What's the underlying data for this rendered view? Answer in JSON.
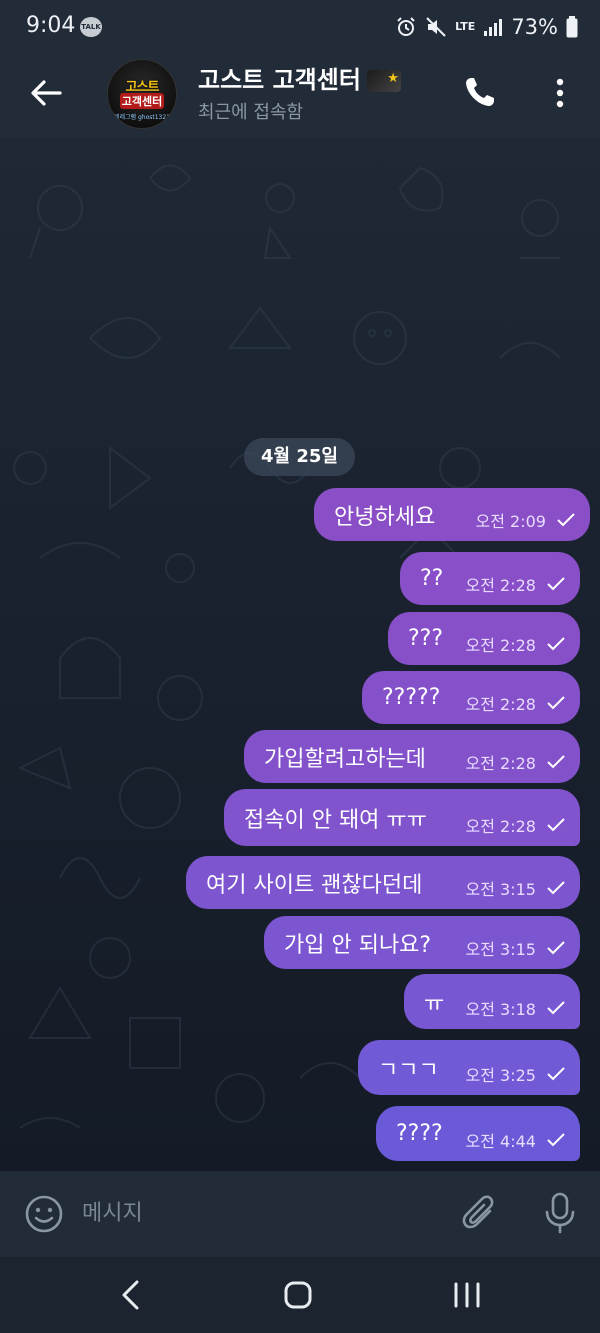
{
  "status_bar": {
    "time": "9:04",
    "talk_badge": "TALK",
    "network": "LTE",
    "battery": "73%"
  },
  "header": {
    "title": "고스트 고객센터",
    "subtitle": "최근에 접속함",
    "avatar_text": {
      "line1": "고스트",
      "line2": "고객센터",
      "line3": "텔레그램 ghost1321"
    }
  },
  "date_separator": "4월 25일",
  "messages": [
    {
      "text": "안녕하세요",
      "time": "오전 2:09",
      "read": true
    },
    {
      "text": "??",
      "time": "오전 2:28",
      "read": true
    },
    {
      "text": "???",
      "time": "오전 2:28",
      "read": true
    },
    {
      "text": "?????",
      "time": "오전 2:28",
      "read": true
    },
    {
      "text": "가입할려고하는데",
      "time": "오전 2:28",
      "read": true
    },
    {
      "text": "접속이 안 돼여 ㅠㅠ",
      "time": "오전 2:28",
      "read": true
    },
    {
      "text": "여기 사이트 괜찮다던데",
      "time": "오전 3:15",
      "read": true
    },
    {
      "text": "가입 안 되나요?",
      "time": "오전 3:15",
      "read": true
    },
    {
      "text": "ㅠ",
      "time": "오전 3:18",
      "read": true
    },
    {
      "text": "ㄱㄱㄱ",
      "time": "오전 3:25",
      "read": true
    },
    {
      "text": "????",
      "time": "오전 4:44",
      "read": true
    }
  ],
  "input": {
    "placeholder": "메시지"
  },
  "colors": {
    "bubble_top": "#8a4fc7",
    "bubble_bottom": "#6a5ad8",
    "header_bg": "#222b38",
    "chat_bg": "#1a2230"
  },
  "icons": {
    "back": "arrow-left-icon",
    "call": "phone-icon",
    "more": "more-vertical-icon",
    "emoji": "smile-icon",
    "attach": "paperclip-icon",
    "mic": "microphone-icon"
  }
}
